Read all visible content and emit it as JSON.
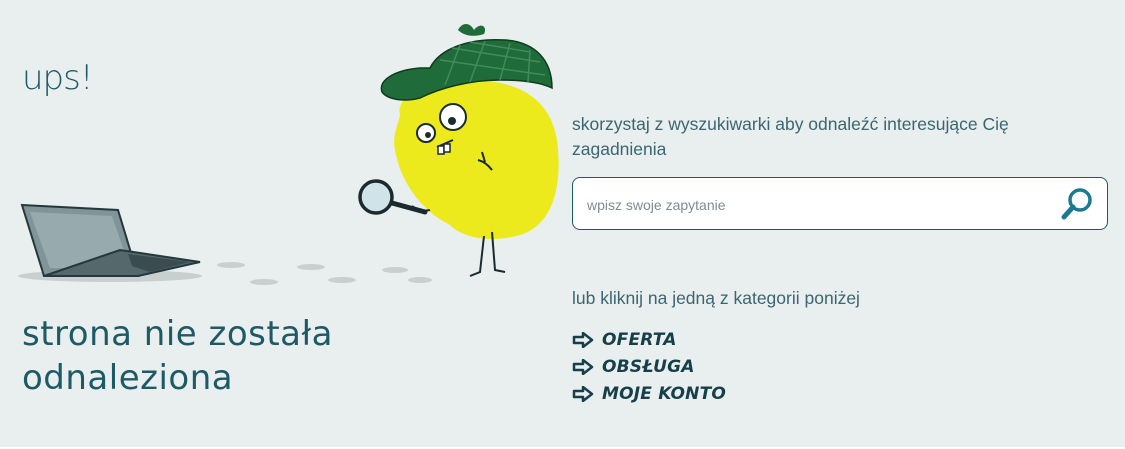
{
  "page": {
    "title_short": "ups!",
    "title_long": "strona nie została odnaleziona"
  },
  "search": {
    "hint": "skorzystaj z wyszukiwarki aby odnaleźć interesujące Cię zagadnienia",
    "placeholder": "wpisz swoje zapytanie",
    "button_icon": "search-icon"
  },
  "categories": {
    "intro": "lub kliknij na jedną z kategorii poniżej",
    "items": [
      {
        "label": "OFERTA",
        "icon": "arrow-right-icon"
      },
      {
        "label": "OBSŁUGA",
        "icon": "arrow-right-icon"
      },
      {
        "label": "MOJE KONTO",
        "icon": "arrow-right-icon"
      }
    ]
  },
  "colors": {
    "background": "#e9eeee",
    "primary": "#1d5a66",
    "text": "#3b6670",
    "character_yellow": "#ece91d",
    "hat_green": "#1f6b3a",
    "laptop_gray": "#7f9598"
  }
}
